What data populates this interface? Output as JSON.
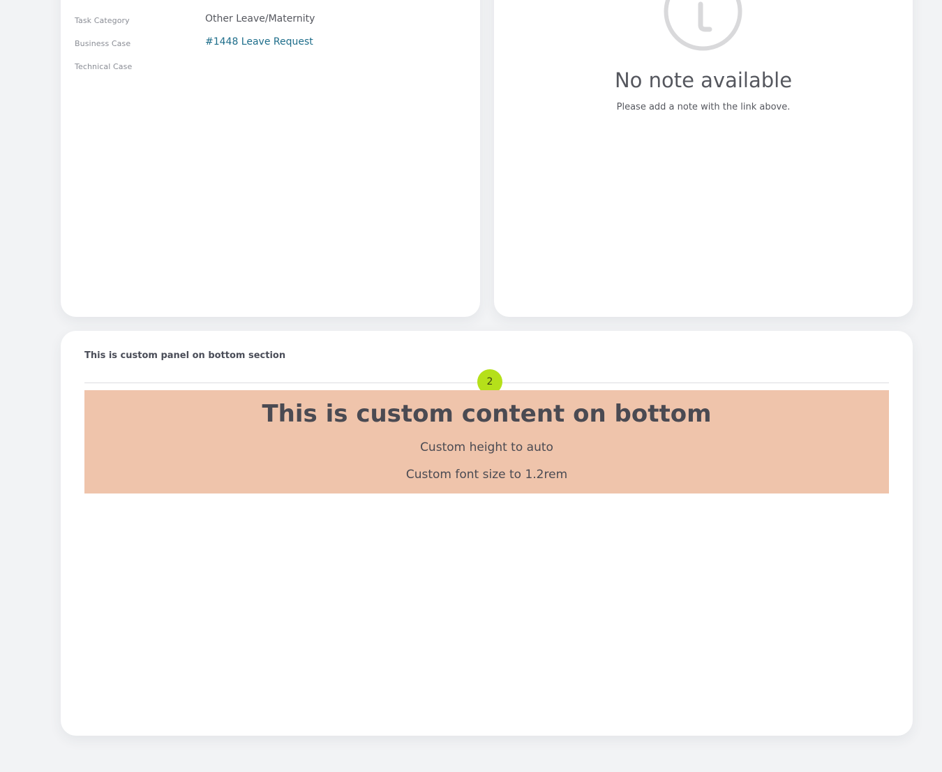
{
  "details": {
    "rows": [
      {
        "label": "Task Category",
        "value": "Other Leave/Maternity"
      },
      {
        "label": "Business Case",
        "value": "#1448 Leave Request"
      },
      {
        "label": "Technical Case",
        "value": ""
      }
    ]
  },
  "notes": {
    "icon": "info-icon",
    "title": "No note available",
    "subtitle": "Please add a note with the link above."
  },
  "bottom": {
    "title": "This is custom panel on bottom section",
    "badge": "2",
    "content": {
      "heading": "This is custom content on bottom",
      "line1": "Custom height to auto",
      "line2": "Custom font size to 1.2rem"
    }
  },
  "colors": {
    "page_background": "#f2f3f5",
    "link": "#1d6d8a",
    "badge": "#b5e01a",
    "custom_content_background": "#efc4ab"
  }
}
